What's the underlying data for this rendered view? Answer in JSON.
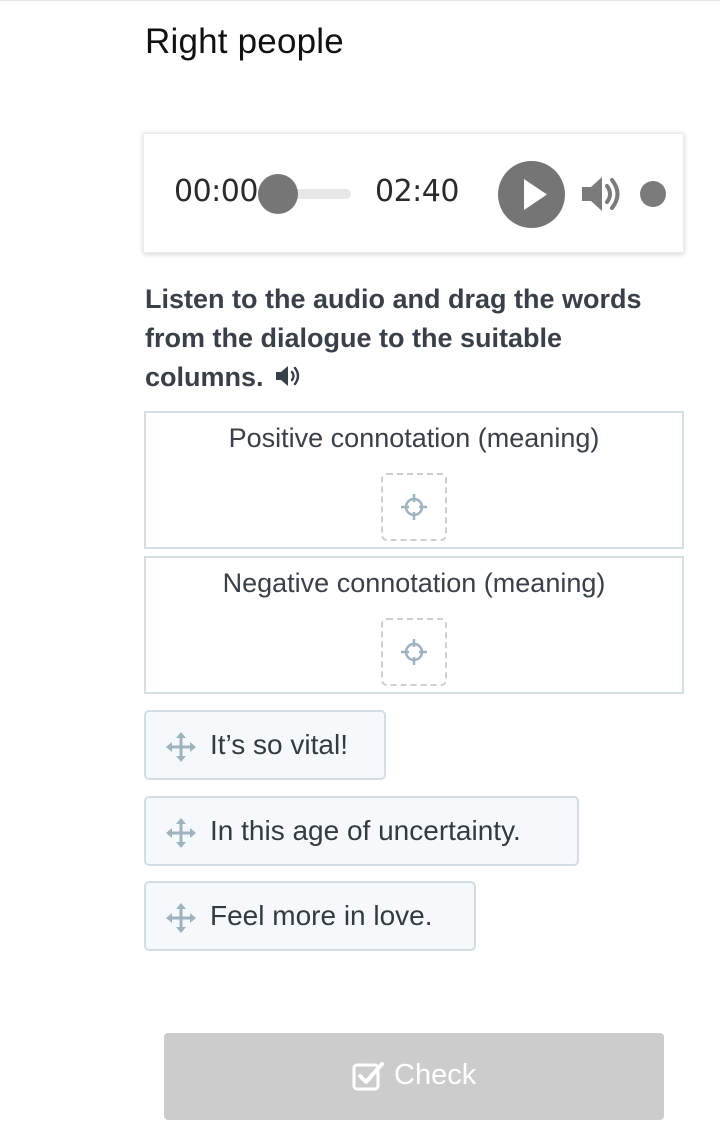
{
  "page": {
    "title": "Right people"
  },
  "audio": {
    "current_time": "00:00",
    "total_time": "02:40",
    "progress": 0,
    "icons": {
      "play": "play-icon",
      "volume": "volume-icon"
    }
  },
  "instructions": {
    "text": "Listen to the audio and drag the words from the dialogue to the suitable columns.",
    "icon": "speaker-icon"
  },
  "columns": [
    {
      "title": "Positive connotation (meaning)",
      "icon": "crosshair-icon"
    },
    {
      "title": "Negative connotation (meaning)",
      "icon": "crosshair-icon"
    }
  ],
  "words": [
    {
      "label": "It’s so vital!",
      "icon": "move-icon"
    },
    {
      "label": "In this age of uncertainty.",
      "icon": "move-icon"
    },
    {
      "label": "Feel more in love.",
      "icon": "move-icon"
    }
  ],
  "actions": {
    "check_label": "Check",
    "check_icon": "checkbox-icon",
    "check_enabled": false
  },
  "colors": {
    "player_control": "#757575",
    "chip_background": "#f5f9fc",
    "chip_border": "#d3dde3",
    "button_disabled": "#cccccc",
    "drop_target_icon": "#9fb3bf"
  }
}
